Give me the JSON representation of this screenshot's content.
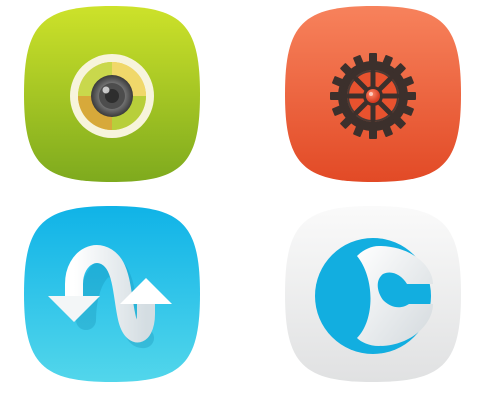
{
  "icons": [
    {
      "name": "camera-icon",
      "colors": {
        "bg_light": "#c9e028",
        "bg_dark": "#7fae1e",
        "ring": "#f6f3dc",
        "lens": "#5a5a5a"
      }
    },
    {
      "name": "settings-gear-icon",
      "colors": {
        "bg_light": "#f47a52",
        "bg_dark": "#e4502a",
        "gear": "#3b2f2c",
        "hub": "#e2472c"
      }
    },
    {
      "name": "sync-arrows-icon",
      "colors": {
        "bg_light": "#14b6e8",
        "bg_dark": "#4fd3ea",
        "ribbon": "#f4f6f7"
      }
    },
    {
      "name": "launcher-icon",
      "colors": {
        "bg_light": "#ffffff",
        "bg_dark": "#e4e5e6",
        "circle": "#11aee0",
        "glyph": "#eef1f3"
      }
    }
  ]
}
